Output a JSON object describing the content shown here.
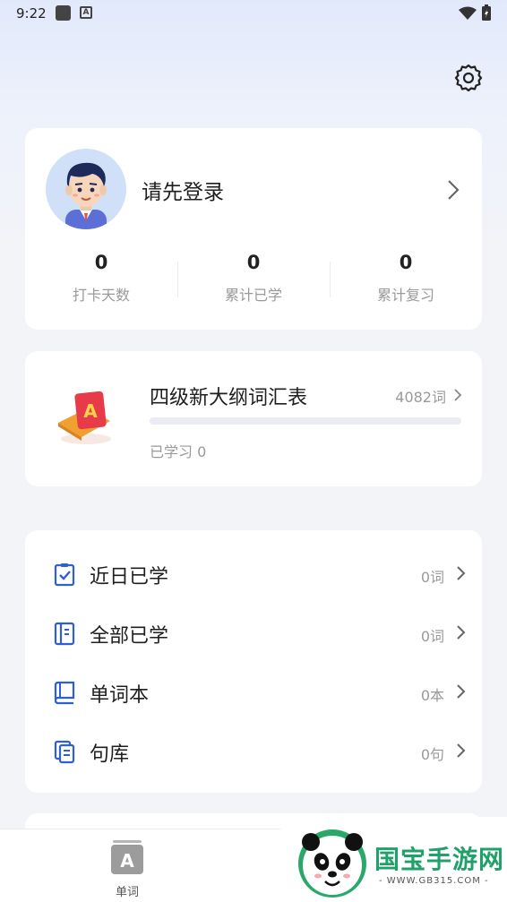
{
  "status_bar": {
    "time": "9:22"
  },
  "profile": {
    "login_prompt": "请先登录",
    "stats": [
      {
        "value": "0",
        "label": "打卡天数"
      },
      {
        "value": "0",
        "label": "累计已学"
      },
      {
        "value": "0",
        "label": "累计复习"
      }
    ]
  },
  "book": {
    "icon_letter": "A",
    "title": "四级新大纲词汇表",
    "word_count": "4082词",
    "learned": "已学习 0",
    "progress_fraction": 0
  },
  "menu": {
    "items": [
      {
        "label": "近日已学",
        "value": "0词",
        "icon": "checklist-icon"
      },
      {
        "label": "全部已学",
        "value": "0词",
        "icon": "notebook-icon"
      },
      {
        "label": "单词本",
        "value": "0本",
        "icon": "book-icon"
      },
      {
        "label": "句库",
        "value": "0句",
        "icon": "documents-icon"
      }
    ]
  },
  "tabbar": {
    "tab_words_label": "单词",
    "tab_icon_letter": "A"
  },
  "watermark": {
    "text": "国宝手游网",
    "url": "- WWW.GB315.COM -"
  },
  "colors": {
    "accent": "#2f5fd6",
    "book_red": "#e83b4a",
    "book_orange": "#f0a030",
    "progress": "#5b7ff0"
  }
}
